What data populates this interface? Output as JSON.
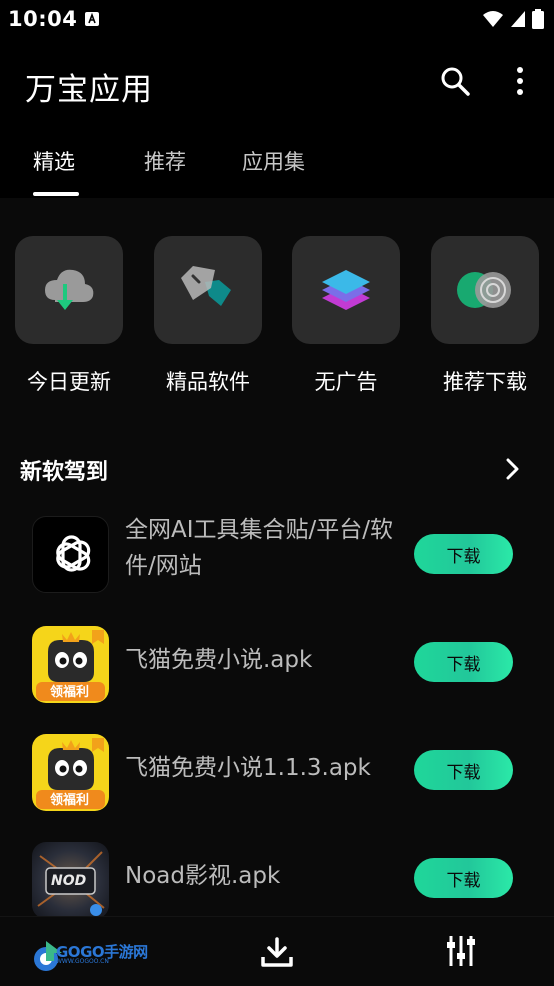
{
  "status_bar": {
    "time": "10:04"
  },
  "app_bar": {
    "title": "万宝应用"
  },
  "tabs": [
    {
      "label": "精选"
    },
    {
      "label": "推荐"
    },
    {
      "label": "应用集"
    }
  ],
  "categories": [
    {
      "label": "今日更新",
      "icon": "cloud-download-icon"
    },
    {
      "label": "精品软件",
      "icon": "gem-icon"
    },
    {
      "label": "无广告",
      "icon": "layers-icon"
    },
    {
      "label": "推荐下载",
      "icon": "target-icon"
    }
  ],
  "section": {
    "title": "新软驾到"
  },
  "apps": [
    {
      "name": "全网AI工具集合贴/平台/软件/网站",
      "button": "下载",
      "icon": "openai-logo-icon"
    },
    {
      "name": "飞猫免费小说.apk",
      "button": "下载",
      "icon": "cat-app-icon",
      "badge": "领福利"
    },
    {
      "name": "飞猫免费小说1.1.3.apk",
      "button": "下载",
      "icon": "cat-app-icon",
      "badge": "领福利"
    },
    {
      "name": "Noad影视.apk",
      "button": "下载",
      "icon": "noad-app-icon",
      "logo_text": "NOD"
    }
  ],
  "bottom_bar": {
    "watermark": "GOGO手游网",
    "watermark_sub": "WWW.GOGOO.CN"
  },
  "colors": {
    "background": "#000000",
    "accent_gradient_start": "#1fd79a",
    "accent_gradient_end": "#2be9a8",
    "tile": "#2c2c2c"
  }
}
